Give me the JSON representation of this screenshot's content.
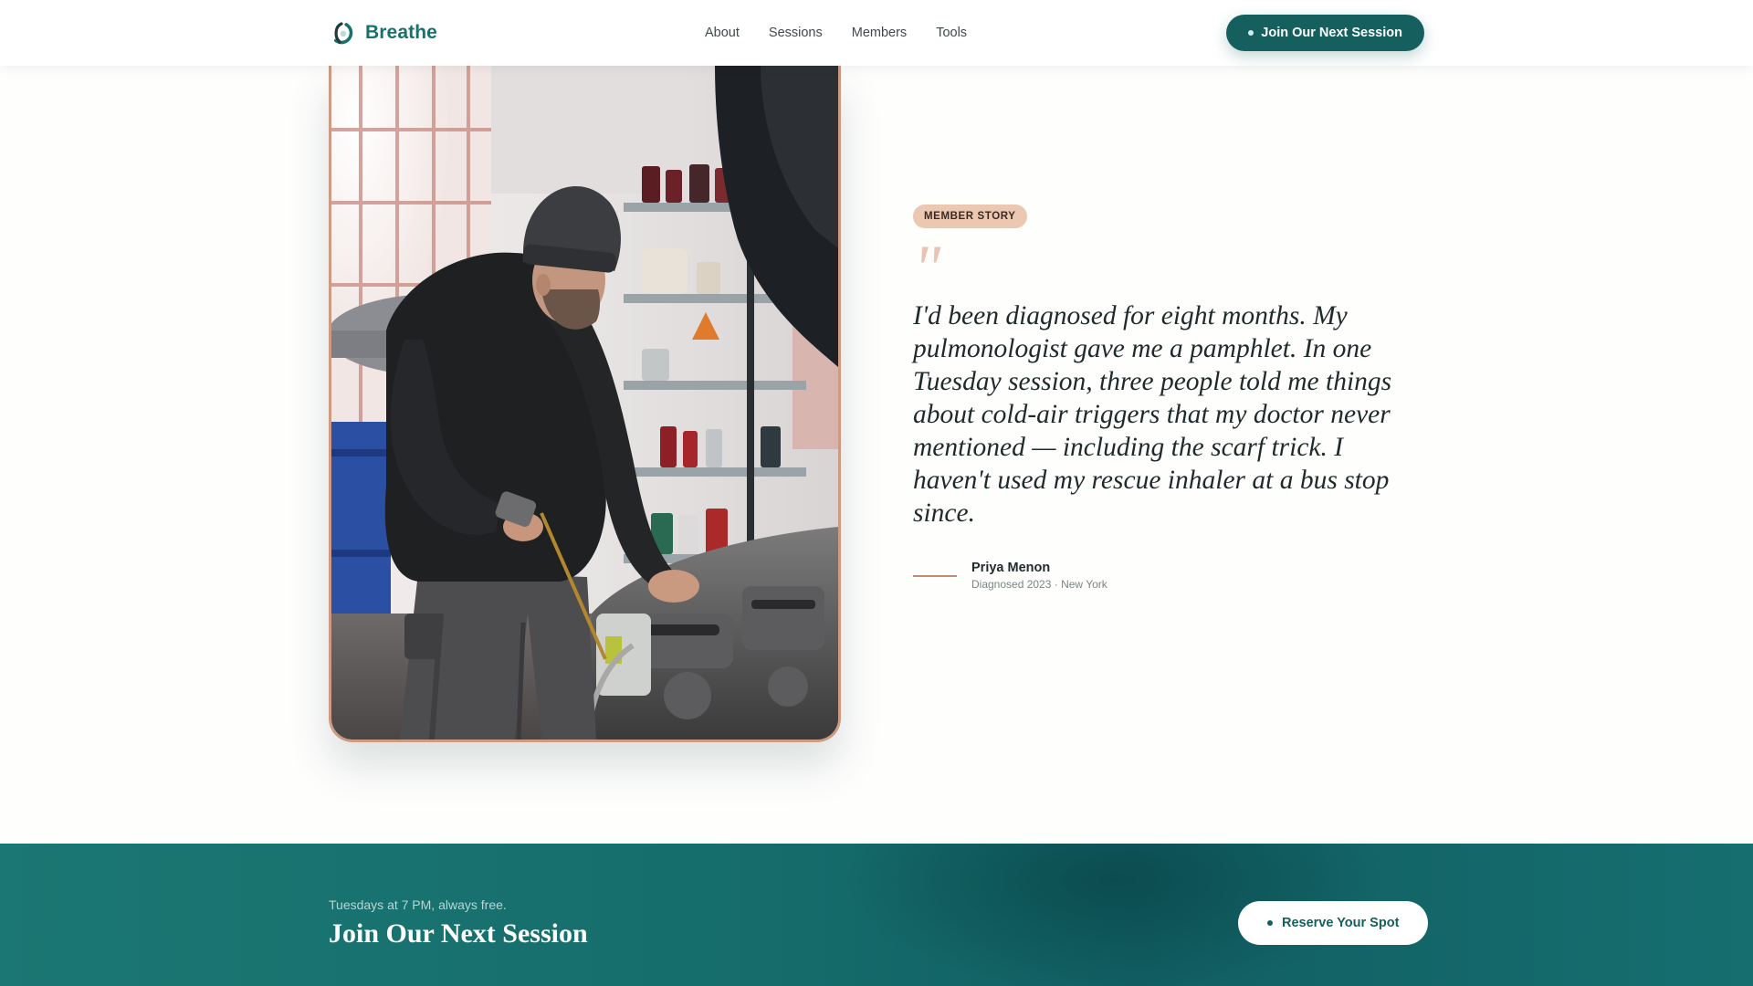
{
  "brand": {
    "name": "Breathe",
    "logo_icon": "breathe-logo-icon"
  },
  "nav": {
    "links": [
      "About",
      "Sessions",
      "Members",
      "Tools"
    ],
    "cta_label": "Join Our Next Session"
  },
  "hero": {
    "photo_icon": "mechanic-photo"
  },
  "testimonial": {
    "badge": "MEMBER STORY",
    "quote_mark": "\"",
    "quote": "I'd been diagnosed for eight months. My pulmonologist gave me a pamphlet. In one Tuesday session, three people told me things about cold-air triggers that my doctor never mentioned — including the scarf trick. I haven't used my rescue inhaler at a bus stop since.",
    "author_name": "Priya Menon",
    "author_meta": "Diagnosed 2023 · New York"
  },
  "cta_band": {
    "subtitle": "Tuesdays at 7 PM, always free.",
    "title": "Join Our Next Session",
    "button_label": "Reserve Your Spot"
  },
  "colors": {
    "brand_teal": "#15605f",
    "accent_clay": "#cf9a82",
    "badge_bg": "#ecc7b1"
  }
}
